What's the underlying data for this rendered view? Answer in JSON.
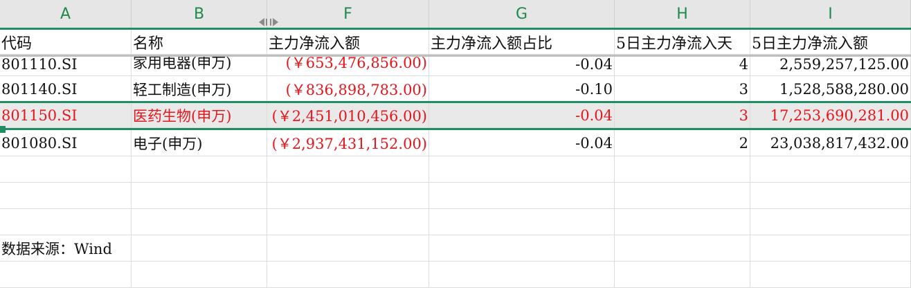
{
  "columns": [
    "A",
    "B",
    "F",
    "G",
    "H",
    "I"
  ],
  "headers": [
    "代码",
    "名称",
    "主力净流入额",
    "主力净流入额占比",
    "5日主力净流入天",
    "5日主力净流入额"
  ],
  "rows": [
    {
      "code": "801110.SI",
      "name": "家用电器(申万)",
      "net_inflow": "(￥653,476,856.00)",
      "ratio": "-0.04",
      "days": "4",
      "inflow_5d": "2,559,257,125.00"
    },
    {
      "code": "801140.SI",
      "name": "轻工制造(申万)",
      "net_inflow": "(￥836,898,783.00)",
      "ratio": "-0.10",
      "days": "3",
      "inflow_5d": "1,528,588,280.00"
    },
    {
      "code": "801150.SI",
      "name": "医药生物(申万)",
      "net_inflow": "(￥2,451,010,456.00)",
      "ratio": "-0.04",
      "days": "3",
      "inflow_5d": "17,253,690,281.00"
    },
    {
      "code": "801080.SI",
      "name": "电子(申万)",
      "net_inflow": "(￥2,937,431,152.00)",
      "ratio": "-0.04",
      "days": "2",
      "inflow_5d": "23,038,817,432.00"
    }
  ],
  "source_note": "数据来源：Wind",
  "colors": {
    "accent": "#1f8f63",
    "negative": "#e8151c",
    "selected_bg": "#e9e9e9"
  }
}
